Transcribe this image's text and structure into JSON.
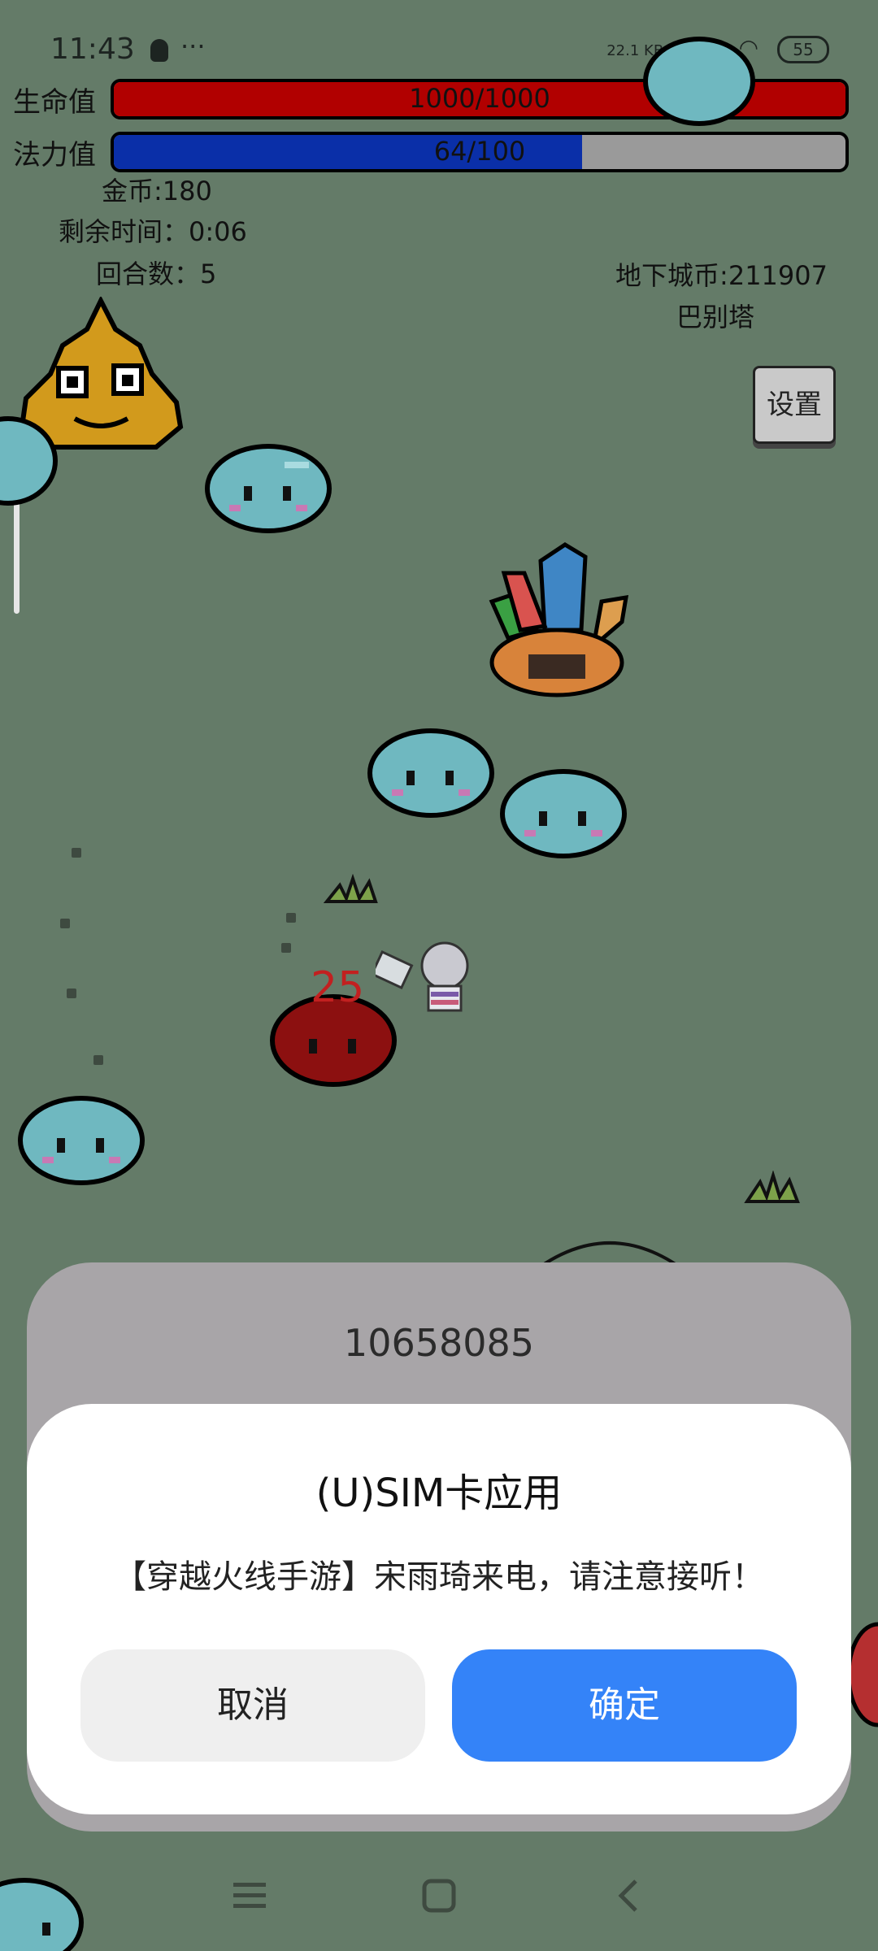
{
  "status_bar": {
    "time": "11:43",
    "network_speed": "22.1 KB/s",
    "battery": "55"
  },
  "hud": {
    "hp_label": "生命值",
    "hp_text": "1000/1000",
    "hp_fraction": 1.0,
    "mp_label": "法力值",
    "mp_text": "64/100",
    "mp_fraction": 0.64,
    "gold": "金币:180",
    "time_left": "剩余时间：0:06",
    "round": "回合数：5",
    "dungeon_coins": "地下城币:211907",
    "location": "巴别塔",
    "settings_label": "设置"
  },
  "game": {
    "damage_number": "25"
  },
  "dialog": {
    "number": "10658085",
    "title": "(U)SIM卡应用",
    "message": "【穿越火线手游】宋雨琦来电，请注意接听！",
    "cancel_label": "取消",
    "ok_label": "确定"
  },
  "colors": {
    "background": "#647b68",
    "hp_bar": "#b10000",
    "mp_bar": "#0a2fa8",
    "ok_button": "#3483f8"
  },
  "navbar": {
    "icons": [
      "menu-icon",
      "home-icon",
      "back-icon"
    ]
  }
}
